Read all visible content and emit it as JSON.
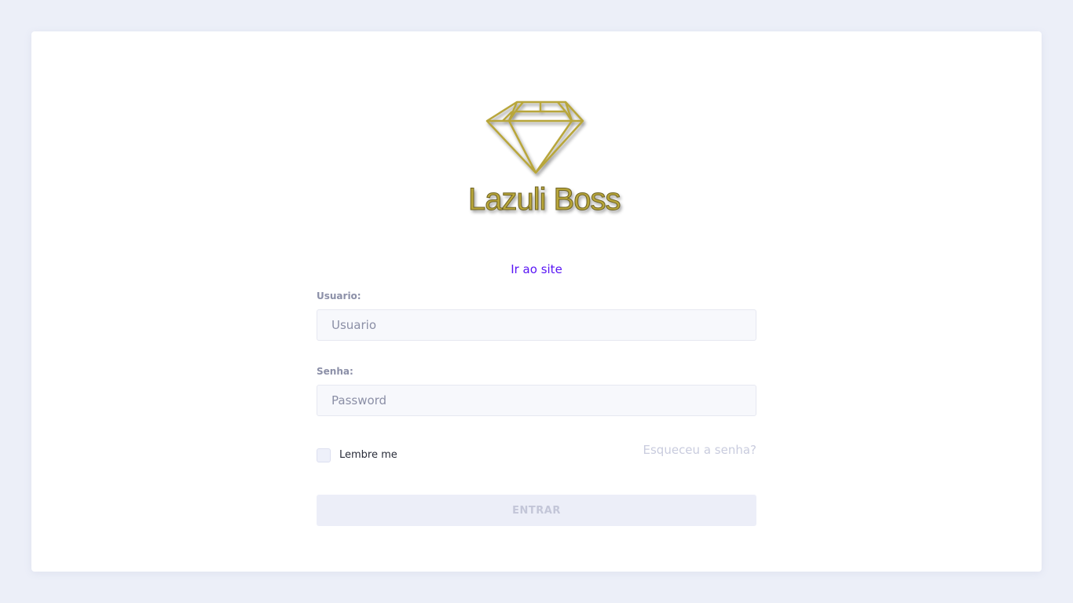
{
  "brand": {
    "name": "Lazuli Boss",
    "logo_icon": "diamond-icon",
    "logo_color": "#b8a63a"
  },
  "site_link": "Ir ao site",
  "form": {
    "username_label": "Usuario:",
    "username_placeholder": "Usuario",
    "username_value": "",
    "password_label": "Senha:",
    "password_placeholder": "Password",
    "password_value": "",
    "remember_label": "Lembre me",
    "remember_checked": false,
    "forgot_label": "Esqueceu a senha?",
    "submit_label": "ENTRAR"
  },
  "colors": {
    "background": "#eceff8",
    "link": "#5a16f5",
    "button_bg": "#eceef8"
  }
}
